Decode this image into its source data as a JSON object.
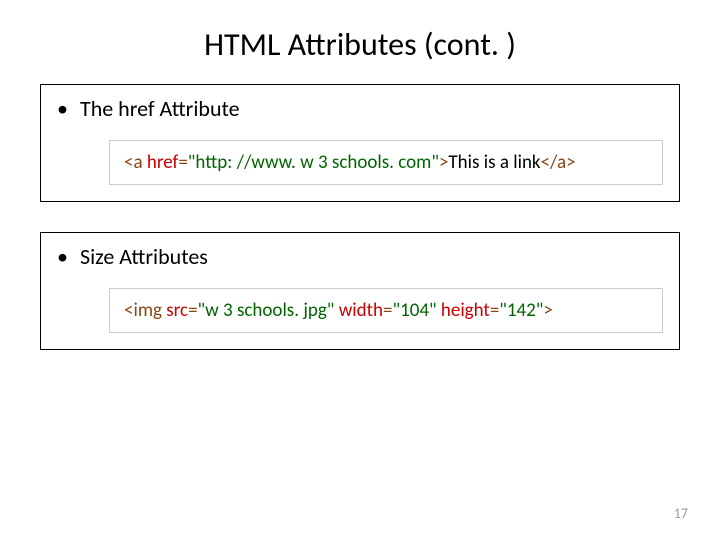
{
  "title": "HTML Attributes (cont. )",
  "section1": {
    "bullet": "•",
    "heading": "The href Attribute",
    "code": {
      "open_bracket": "<",
      "tag_a": "a",
      "space1": " ",
      "attr_href": "href",
      "eq1": "=",
      "val_href": "\"http: //www. w 3 schools. com\"",
      "close_bracket1": ">",
      "link_text": "This is a link",
      "open_bracket2": "</",
      "tag_a2": "a",
      "close_bracket2": ">"
    }
  },
  "section2": {
    "bullet": "•",
    "heading": "Size Attributes",
    "code": {
      "open_bracket": "<",
      "tag_img": "img",
      "space1": " ",
      "attr_src": "src",
      "eq1": "=",
      "val_src": "\"w 3 schools. jpg\"",
      "space2": " ",
      "attr_width": "width",
      "eq2": "=",
      "val_width": "\"104\"",
      "space3": " ",
      "attr_height": "height",
      "eq3": "=",
      "val_height": "\"142\"",
      "close_bracket": ">"
    }
  },
  "page_number": "17"
}
